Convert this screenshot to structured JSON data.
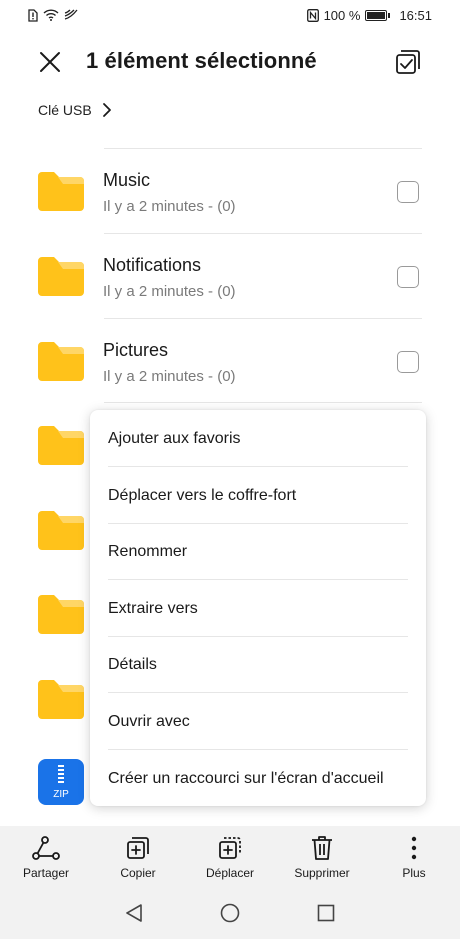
{
  "status_bar": {
    "battery_text": "100 %",
    "time": "16:51"
  },
  "header": {
    "title": "1 élément sélectionné",
    "close_icon": "close-icon",
    "select_all_icon": "select-all-icon"
  },
  "breadcrumb": {
    "label": "Clé USB"
  },
  "files": [
    {
      "name": "Music",
      "meta": "Il y a 2 minutes - (0)"
    },
    {
      "name": "Notifications",
      "meta": "Il y a 2 minutes - (0)"
    },
    {
      "name": "Pictures",
      "meta": "Il y a 2 minutes - (0)"
    }
  ],
  "zip_label": "ZIP",
  "context_menu": {
    "items": [
      "Ajouter aux favoris",
      "Déplacer vers le coffre-fort",
      "Renommer",
      "Extraire vers",
      "Détails",
      "Ouvrir avec",
      "Créer un raccourci sur l'écran d'accueil"
    ]
  },
  "toolbar": {
    "items": [
      {
        "label": "Partager",
        "icon": "share-icon"
      },
      {
        "label": "Copier",
        "icon": "copy-icon"
      },
      {
        "label": "Déplacer",
        "icon": "move-icon"
      },
      {
        "label": "Supprimer",
        "icon": "trash-icon"
      },
      {
        "label": "Plus",
        "icon": "more-icon"
      }
    ]
  },
  "colors": {
    "folder": "#FFC21A",
    "folder_tab": "#FFD666",
    "zip": "#1A73E8",
    "toolbar_bg": "#F2F2F2"
  }
}
